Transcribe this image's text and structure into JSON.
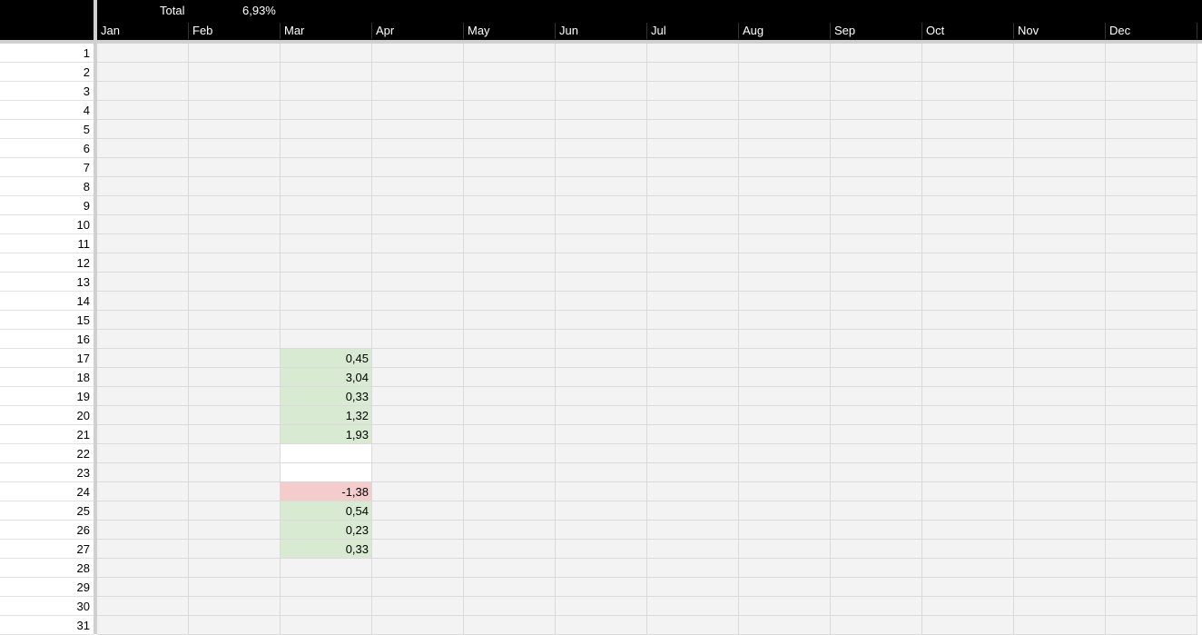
{
  "header": {
    "total_label": "Total",
    "total_value": "6,93%"
  },
  "months": [
    "Jan",
    "Feb",
    "Mar",
    "Apr",
    "May",
    "Jun",
    "Jul",
    "Aug",
    "Sep",
    "Oct",
    "Nov",
    "Dec"
  ],
  "rows": [
    "1",
    "2",
    "3",
    "4",
    "5",
    "6",
    "7",
    "8",
    "9",
    "10",
    "11",
    "12",
    "13",
    "14",
    "15",
    "16",
    "17",
    "18",
    "19",
    "20",
    "21",
    "22",
    "23",
    "24",
    "25",
    "26",
    "27",
    "28",
    "29",
    "30",
    "31"
  ],
  "march_values": [
    {
      "row": 17,
      "value": "0,45",
      "status": "positive"
    },
    {
      "row": 18,
      "value": "3,04",
      "status": "positive"
    },
    {
      "row": 19,
      "value": "0,33",
      "status": "positive"
    },
    {
      "row": 20,
      "value": "1,32",
      "status": "positive"
    },
    {
      "row": 21,
      "value": "1,93",
      "status": "positive"
    },
    {
      "row": 22,
      "value": "",
      "status": "empty"
    },
    {
      "row": 23,
      "value": "",
      "status": "empty"
    },
    {
      "row": 24,
      "value": "-1,38",
      "status": "negative"
    },
    {
      "row": 25,
      "value": "0,54",
      "status": "positive"
    },
    {
      "row": 26,
      "value": "0,23",
      "status": "positive"
    },
    {
      "row": 27,
      "value": "0,33",
      "status": "positive"
    }
  ],
  "colors": {
    "header_bg": "#000000",
    "cell_bg": "#f3f3f3",
    "positive_bg": "#d9ead3",
    "negative_bg": "#f4cccc",
    "grid_line": "#dadada"
  }
}
